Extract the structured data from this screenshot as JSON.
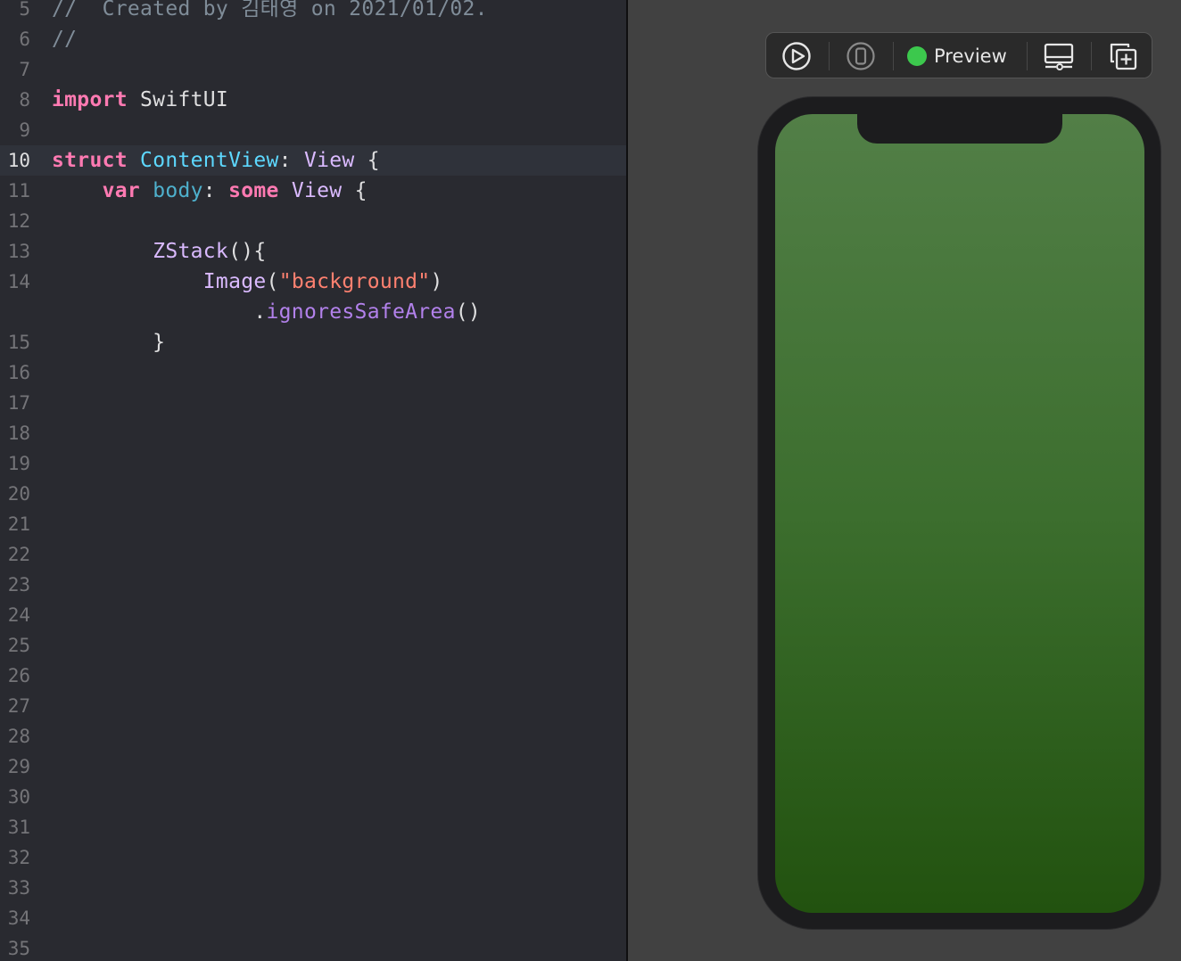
{
  "editor": {
    "lines": [
      {
        "num": "5",
        "tokens": [
          {
            "t": "comment",
            "v": "//  Created by 김태영 on 2021/01/02."
          }
        ]
      },
      {
        "num": "6",
        "tokens": [
          {
            "t": "comment",
            "v": "//"
          }
        ]
      },
      {
        "num": "7",
        "tokens": []
      },
      {
        "num": "8",
        "tokens": [
          {
            "t": "kw",
            "v": "import"
          },
          {
            "t": "plain",
            "v": " SwiftUI"
          }
        ]
      },
      {
        "num": "9",
        "tokens": []
      },
      {
        "num": "10",
        "current": true,
        "tokens": [
          {
            "t": "kw",
            "v": "struct"
          },
          {
            "t": "plain",
            "v": " "
          },
          {
            "t": "type-decl",
            "v": "ContentView"
          },
          {
            "t": "plain",
            "v": ": "
          },
          {
            "t": "type",
            "v": "View"
          },
          {
            "t": "plain",
            "v": " {"
          }
        ]
      },
      {
        "num": "11",
        "tokens": [
          {
            "t": "plain",
            "v": "    "
          },
          {
            "t": "kw",
            "v": "var"
          },
          {
            "t": "plain",
            "v": " "
          },
          {
            "t": "prop",
            "v": "body"
          },
          {
            "t": "plain",
            "v": ": "
          },
          {
            "t": "kw",
            "v": "some"
          },
          {
            "t": "plain",
            "v": " "
          },
          {
            "t": "type",
            "v": "View"
          },
          {
            "t": "plain",
            "v": " {"
          }
        ]
      },
      {
        "num": "12",
        "tokens": []
      },
      {
        "num": "13",
        "tokens": [
          {
            "t": "plain",
            "v": "        "
          },
          {
            "t": "type",
            "v": "ZStack"
          },
          {
            "t": "plain",
            "v": "(){"
          }
        ]
      },
      {
        "num": "14",
        "tokens": [
          {
            "t": "plain",
            "v": "            "
          },
          {
            "t": "type",
            "v": "Image"
          },
          {
            "t": "plain",
            "v": "("
          },
          {
            "t": "str",
            "v": "\"background\""
          },
          {
            "t": "plain",
            "v": ")"
          }
        ]
      },
      {
        "num": "",
        "tokens": [
          {
            "t": "plain",
            "v": "                ."
          },
          {
            "t": "func",
            "v": "ignoresSafeArea"
          },
          {
            "t": "plain",
            "v": "()"
          }
        ]
      },
      {
        "num": "15",
        "tokens": [
          {
            "t": "plain",
            "v": "        }"
          }
        ]
      },
      {
        "num": "16",
        "tokens": []
      },
      {
        "num": "17",
        "tokens": []
      },
      {
        "num": "18",
        "tokens": []
      },
      {
        "num": "19",
        "tokens": []
      },
      {
        "num": "20",
        "tokens": []
      },
      {
        "num": "21",
        "tokens": []
      },
      {
        "num": "22",
        "tokens": []
      },
      {
        "num": "23",
        "tokens": []
      },
      {
        "num": "24",
        "tokens": []
      },
      {
        "num": "25",
        "tokens": []
      },
      {
        "num": "26",
        "tokens": []
      },
      {
        "num": "27",
        "tokens": []
      },
      {
        "num": "28",
        "tokens": []
      },
      {
        "num": "29",
        "tokens": []
      },
      {
        "num": "30",
        "tokens": []
      },
      {
        "num": "31",
        "tokens": []
      },
      {
        "num": "32",
        "tokens": []
      },
      {
        "num": "33",
        "tokens": []
      },
      {
        "num": "34",
        "tokens": []
      },
      {
        "num": "35",
        "tokens": []
      }
    ]
  },
  "preview_toolbar": {
    "status_label": "Preview",
    "status_color": "#3cc84d",
    "buttons": [
      "live-preview-icon",
      "preview-on-device-icon",
      "inspect-preview-icon",
      "duplicate-preview-icon"
    ]
  },
  "device": {
    "screen_gradient": [
      "#527f47",
      "#3c6e2e",
      "#22520f"
    ]
  }
}
